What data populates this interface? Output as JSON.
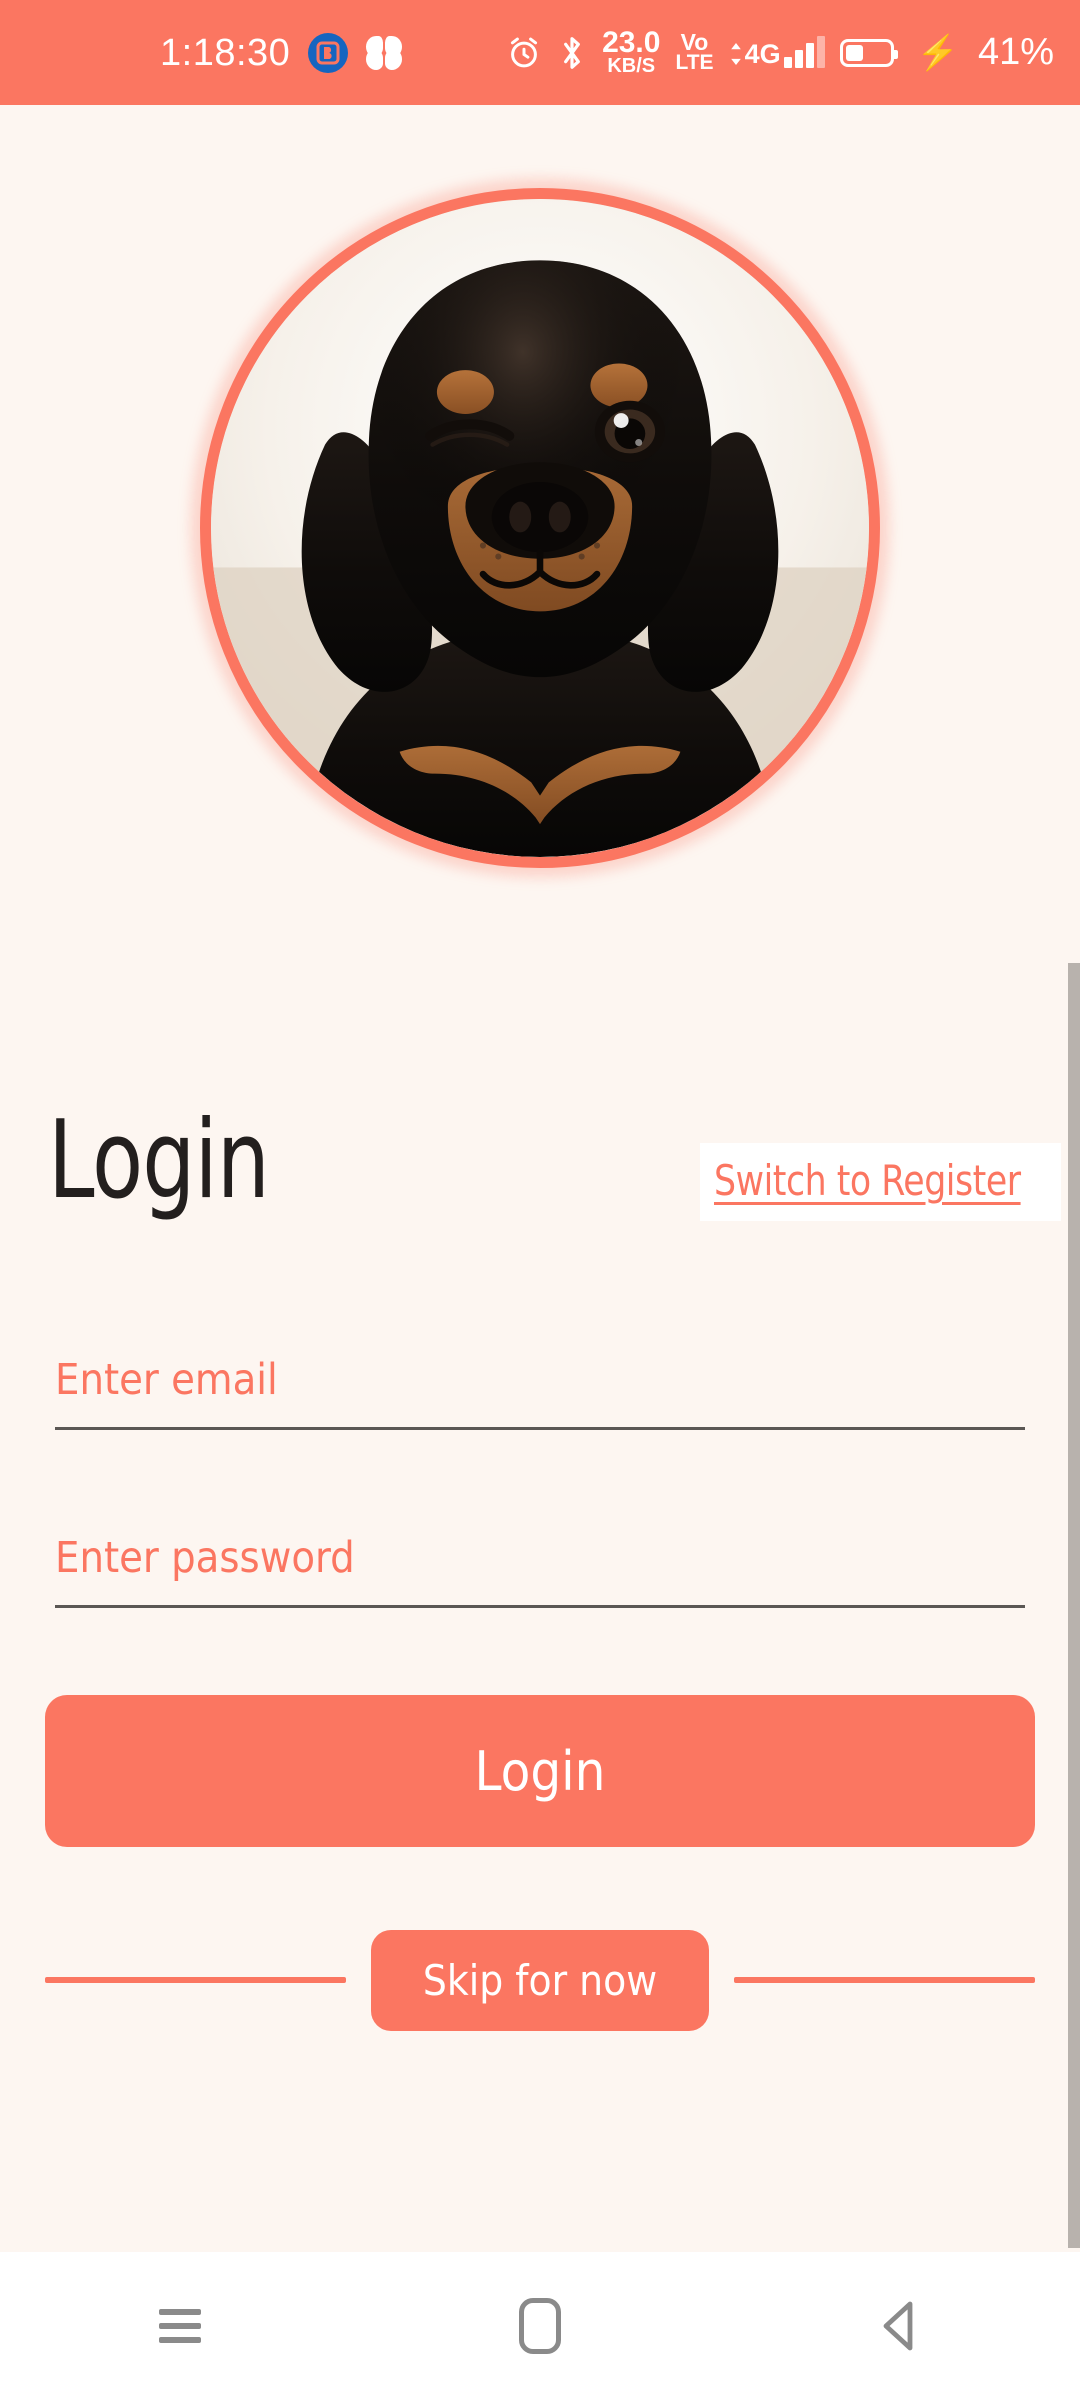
{
  "status_bar": {
    "clock": "1:18:30",
    "app_badge_letter": "B",
    "icons": [
      "notification-badge-icon",
      "flower-icon",
      "alarm-icon",
      "bluetooth-icon"
    ],
    "network_speed_value": "23.0",
    "network_speed_unit": "KB/S",
    "volte_line1": "Vo",
    "volte_line2": "LTE",
    "mobile_network": "4G",
    "battery_percent": "41%",
    "battery_level": 41,
    "charging": true,
    "background_color": "#fb7661"
  },
  "app": {
    "background_color": "#fdf6f1",
    "accent_color": "#fb7661",
    "avatar": {
      "alt": "puppy-avatar",
      "description": "Winking black and tan Doberman puppy portrait"
    },
    "heading": {
      "title": "Login",
      "switch_link": "Switch to Register"
    },
    "form": {
      "email_placeholder": "Enter email",
      "email_value": "",
      "password_placeholder": "Enter password",
      "password_value": "",
      "submit_label": "Login"
    },
    "skip": {
      "label": "Skip for now"
    }
  },
  "nav_bar": {
    "recents_label": "recents-menu",
    "home_label": "home",
    "back_label": "back"
  }
}
